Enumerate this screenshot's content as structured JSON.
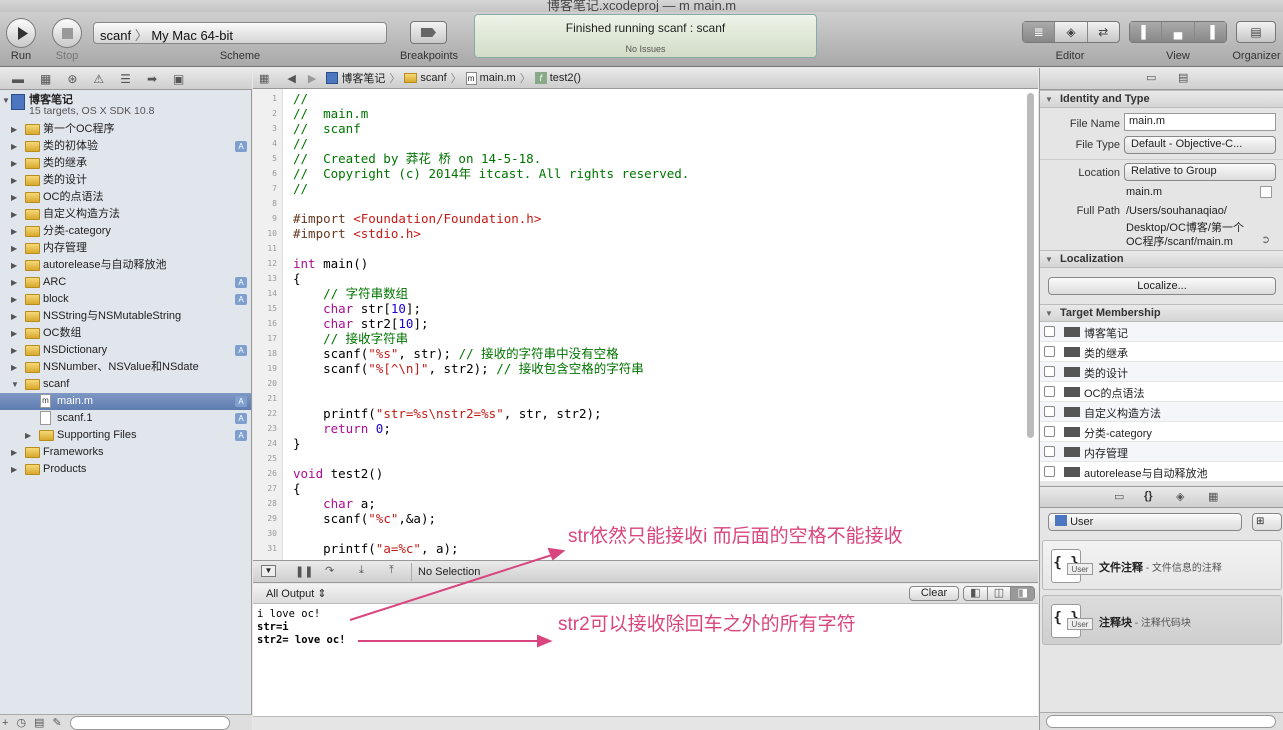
{
  "window": {
    "title": "博客笔记.xcodeproj — m main.m"
  },
  "toolbar": {
    "run_label": "Run",
    "stop_label": "Stop",
    "scheme_target": "scanf",
    "scheme_dest": "My Mac 64-bit",
    "scheme_label": "Scheme",
    "breakpoints_label": "Breakpoints",
    "status_main": "Finished running scanf : scanf",
    "status_sub": "No Issues",
    "editor_label": "Editor",
    "view_label": "View",
    "organizer_label": "Organizer"
  },
  "navigator": {
    "project_name": "博客笔记",
    "project_sub": "15 targets, OS X SDK 10.8",
    "items": [
      {
        "label": "第一个OC程序",
        "badge": ""
      },
      {
        "label": "类的初体验",
        "badge": "A"
      },
      {
        "label": "类的继承",
        "badge": ""
      },
      {
        "label": "类的设计",
        "badge": ""
      },
      {
        "label": "OC的点语法",
        "badge": ""
      },
      {
        "label": "自定义构造方法",
        "badge": ""
      },
      {
        "label": "分类-category",
        "badge": ""
      },
      {
        "label": "内存管理",
        "badge": ""
      },
      {
        "label": "autorelease与自动释放池",
        "badge": ""
      },
      {
        "label": "ARC",
        "badge": "A"
      },
      {
        "label": "block",
        "badge": "A"
      },
      {
        "label": "NSString与NSMutableString",
        "badge": ""
      },
      {
        "label": "OC数组",
        "badge": ""
      },
      {
        "label": "NSDictionary",
        "badge": "A"
      },
      {
        "label": "NSNumber、NSValue和NSdate",
        "badge": ""
      },
      {
        "label": "scanf",
        "badge": ""
      }
    ],
    "scanf_children": [
      {
        "label": "main.m",
        "badge": "A",
        "icon": "m"
      },
      {
        "label": "scanf.1",
        "badge": "A",
        "icon": ""
      },
      {
        "label": "Supporting Files",
        "badge": "A",
        "icon": "folder"
      }
    ],
    "bottom_items": [
      {
        "label": "Frameworks"
      },
      {
        "label": "Products"
      }
    ]
  },
  "jumpbar": {
    "crumbs": [
      "博客笔记",
      "scanf",
      "main.m",
      "test2()"
    ],
    "m_glyph": "m",
    "f_glyph": "f"
  },
  "code": {
    "line_numbers": [
      "1",
      "2",
      "3",
      "4",
      "5",
      "6",
      "7",
      "8",
      "9",
      "10",
      "11",
      "12",
      "13",
      "14",
      "15",
      "16",
      "17",
      "18",
      "19",
      "20",
      "21",
      "22",
      "23",
      "24",
      "25",
      "26",
      "27",
      "28",
      "29",
      "30",
      "31"
    ],
    "l1": "//",
    "l2": "//  main.m",
    "l3": "//  scanf",
    "l4": "//",
    "l5": "//  Created by 莽花 桥 on 14-5-18.",
    "l6": "//  Copyright (c) 2014年 itcast. All rights reserved.",
    "l7": "//",
    "l9_kw": "#import",
    "l9_path": " <Foundation/Foundation.h>",
    "l10_kw": "#import",
    "l10_path": " <stdio.h>",
    "l12_kw": "int",
    "l12_rest": " main()",
    "l13": "{",
    "l14": "    // 字符串数组",
    "l15_kw": "    char",
    "l15_rest": " str[",
    "l15_num": "10",
    "l15_end": "];",
    "l16_kw": "    char",
    "l16_rest": " str2[",
    "l16_num": "10",
    "l16_end": "];",
    "l17": "    // 接收字符串",
    "l18_fn": "    scanf(",
    "l18_str": "\"%s\"",
    "l18_rest": ", str); ",
    "l18_cm": "// 接收的字符串中没有空格",
    "l19_fn": "    scanf(",
    "l19_str": "\"%[^\\n]\"",
    "l19_rest": ", str2); ",
    "l19_cm": "// 接收包含空格的字符串",
    "l22_fn": "    printf(",
    "l22_str": "\"str=%s\\nstr2=%s\"",
    "l22_rest": ", str, str2);",
    "l23_kw": "    return",
    "l23_num": " 0",
    "l23_end": ";",
    "l24": "}",
    "l26_kw": "void",
    "l26_rest": " test2()",
    "l27": "{",
    "l28_kw": "    char",
    "l28_rest": " a;",
    "l29_fn": "    scanf(",
    "l29_str": "\"%c\"",
    "l29_rest": ",&a);",
    "l31_fn": "    printf(",
    "l31_str": "\"a=%c\"",
    "l31_rest": ", a);"
  },
  "debug": {
    "selection": "No Selection"
  },
  "output": {
    "filter": "All Output",
    "clear_label": "Clear",
    "lines": [
      "i love oc!",
      "str=i",
      "str2= love oc!"
    ]
  },
  "annotations": {
    "a1": "str依然只能接收i 而后面的空格不能接收",
    "a2": "str2可以接收除回车之外的所有字符",
    "color": "#d9457e"
  },
  "inspector": {
    "identity_header": "Identity and Type",
    "file_name_label": "File Name",
    "file_name": "main.m",
    "file_type_label": "File Type",
    "file_type": "Default - Objective-C...",
    "location_label": "Location",
    "location": "Relative to Group",
    "location_file": "main.m",
    "full_path_label": "Full Path",
    "full_path_1": "/Users/souhanaqiao/",
    "full_path_2": "Desktop/OC博客/第一个",
    "full_path_3": "OC程序/scanf/main.m",
    "localization_header": "Localization",
    "localize_button": "Localize...",
    "target_header": "Target Membership",
    "targets": [
      "博客笔记",
      "类的继承",
      "类的设计",
      "OC的点语法",
      "自定义构造方法",
      "分类-category",
      "内存管理",
      "autorelease与自动释放池"
    ],
    "library_filter": "User",
    "snippets": [
      {
        "title": "文件注释",
        "desc": " - 文件信息的注释",
        "user": "User"
      },
      {
        "title": "注释块",
        "desc": " - 注释代码块",
        "user": "User"
      }
    ]
  }
}
